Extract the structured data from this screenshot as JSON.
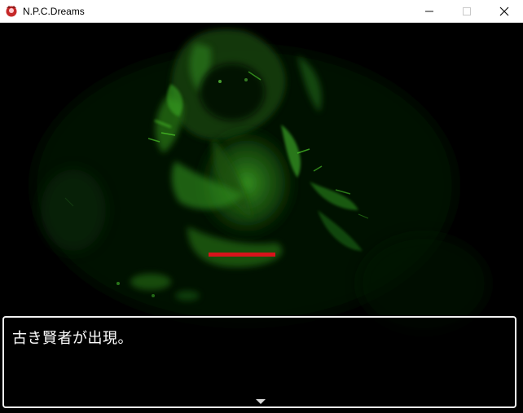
{
  "window": {
    "title": "N.P.C.Dreams",
    "app_icon": "game-app-icon",
    "controls": {
      "minimize": "—",
      "maximize": "☐",
      "close": "✕"
    }
  },
  "battle": {
    "enemy_name": "古き賢者",
    "enemy_sprite": "green-spectral-sage",
    "enemy_hp_fraction": 1.0,
    "hp_color": "#d8131b"
  },
  "message": {
    "text": "古き賢者が出現。",
    "continue_indicator": "down-triangle-icon"
  },
  "colors": {
    "background": "#000000",
    "enemy_glow": "#2f9a1e",
    "window_border": "#f2f2f2"
  }
}
